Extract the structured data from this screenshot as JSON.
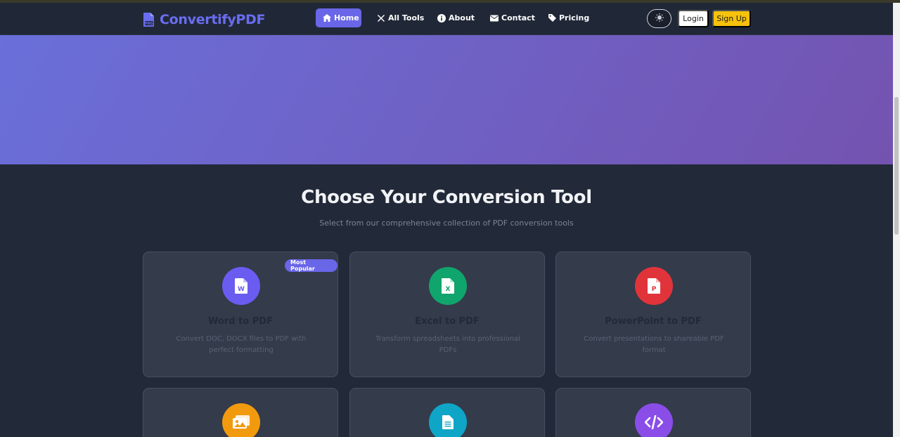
{
  "brand": {
    "name": "ConvertifyPDF",
    "icon": "file-pdf-icon",
    "color": "#6a6df0"
  },
  "nav": {
    "items": [
      {
        "label": "Home",
        "icon": "home-icon",
        "active": true
      },
      {
        "label": "All Tools",
        "icon": "tools-icon",
        "active": false
      },
      {
        "label": "About",
        "icon": "info-icon",
        "active": false
      },
      {
        "label": "Contact",
        "icon": "envelope-icon",
        "active": false
      },
      {
        "label": "Pricing",
        "icon": "tag-icon",
        "active": false
      }
    ],
    "theme_toggle_icon": "theme-icon",
    "login_label": "Login",
    "signup_label": "Sign Up"
  },
  "hero": {
    "gradient_start": "#6a6fd9",
    "gradient_end": "#7453b0"
  },
  "section": {
    "title": "Choose Your Conversion Tool",
    "subtitle": "Select from our comprehensive collection of PDF conversion tools"
  },
  "tools": [
    {
      "title": "Word to PDF",
      "description": "Convert DOC, DOCX files to PDF with perfect formatting",
      "badge": "Most Popular",
      "icon": "file-word-icon",
      "color": "#6a5cf0"
    },
    {
      "title": "Excel to PDF",
      "description": "Transform spreadsheets into professional PDFs",
      "icon": "file-excel-icon",
      "color": "#10a56c"
    },
    {
      "title": "PowerPoint to PDF",
      "description": "Convert presentations to shareable PDF format",
      "icon": "file-powerpoint-icon",
      "color": "#e0343a"
    },
    {
      "icon": "images-icon",
      "color": "#f29a0e"
    },
    {
      "icon": "file-text-icon",
      "color": "#0ea5c6"
    },
    {
      "icon": "code-icon",
      "color": "#8a4de8"
    }
  ]
}
